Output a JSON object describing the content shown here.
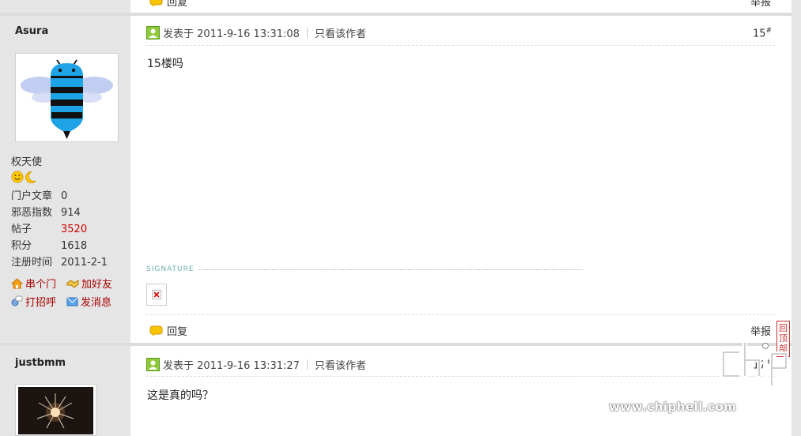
{
  "prev_post": {
    "reply_label": "回复",
    "report_label": "举报"
  },
  "post1": {
    "author": "Asura",
    "rank": "权天使",
    "stats": [
      {
        "label": "门户文章",
        "value": "0",
        "highlight": false
      },
      {
        "label": "邪恶指数",
        "value": "914",
        "highlight": false
      },
      {
        "label": "帖子",
        "value": "3520",
        "highlight": true
      },
      {
        "label": "积分",
        "value": "1618",
        "highlight": false
      },
      {
        "label": "注册时间",
        "value": "2011-2-1",
        "highlight": false
      }
    ],
    "actions": {
      "visit": "串个门",
      "add_friend": "加好友",
      "greet": "打招呼",
      "message": "发消息"
    },
    "posted_at": "发表于 2011-9-16 13:31:08",
    "only_author": "只看该作者",
    "floor": "15",
    "content": "15楼吗",
    "signature_label": "SIGNATURE",
    "reply_label": "回复",
    "report_label": "举报"
  },
  "post2": {
    "author": "justbmm",
    "posted_at": "发表于 2011-9-16 13:31:27",
    "only_author": "只看该作者",
    "floor": "17",
    "content": "这是真的吗？"
  },
  "back_to_top": "回顶部",
  "watermark": {
    "logo": "chiphell",
    "url": "www.chiphell.com"
  },
  "colors": {
    "accent_red": "#cc0000",
    "action_red": "#aa0000",
    "sig_teal": "#6fb0b0"
  }
}
